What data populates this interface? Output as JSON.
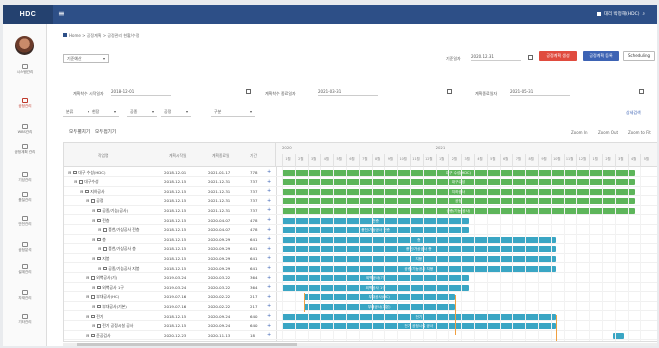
{
  "app": {
    "logo": "HDC",
    "menu_icon": "hamburger-icon"
  },
  "user": {
    "label": "대리 박정해(HDC)",
    "search_icon": "search-icon"
  },
  "sidebar": {
    "items": [
      {
        "label": "시스템관리",
        "icon": "monitor-icon"
      },
      {
        "label": "공정관리",
        "icon": "calendar-icon",
        "active": true
      },
      {
        "label": "WBS관리",
        "icon": "list-icon"
      },
      {
        "label": "공정계획 관리",
        "icon": "plan-icon"
      },
      {
        "label": "기성관리",
        "icon": "chart-icon"
      },
      {
        "label": "품질관리",
        "icon": "check-icon"
      },
      {
        "label": "안전관리",
        "icon": "shield-icon"
      },
      {
        "label": "공정분석",
        "icon": "analysis-icon"
      },
      {
        "label": "설계관리",
        "icon": "design-icon"
      },
      {
        "label": "자재관리",
        "icon": "box-icon"
      },
      {
        "label": "기타관리",
        "icon": "dots-icon"
      }
    ]
  },
  "breadcrumb": "Home > 공정계획 > 공정관리 현황/수정",
  "project_select": "기준예산",
  "version_label": "기준일자",
  "version_date": "2020.12.31",
  "buttons": {
    "publish": "공정계획 생성",
    "baseline": "공정계획 등록",
    "scheduling": "Scheduling"
  },
  "filters": {
    "start_label": "계획착수 시작일자",
    "start_value": "2018-12-01",
    "end_label": "계획착수 종료일자",
    "end_value": "2021-03-31",
    "status_label": "계획종료일자",
    "status_value": "2021-05-31",
    "selects": [
      "분류",
      "현장",
      "공종",
      "공정",
      "구분"
    ],
    "detail_search": "상세검색"
  },
  "gantt_toolbar": {
    "expand": "모두펼치기",
    "collapse": "모두접기기",
    "zoom_in": "Zoom In",
    "zoom_out": "Zoom Out",
    "zoom_fit": "Zoom to Fit"
  },
  "grid_headers": [
    "작업명",
    "계획시작일",
    "계획종료일",
    "기간"
  ],
  "timeline": {
    "years": [
      "2020",
      "2021"
    ],
    "months": [
      "1월",
      "2월",
      "3월",
      "4월",
      "5월",
      "6월",
      "7월",
      "8월",
      "9월",
      "10월",
      "11월",
      "12월",
      "1월",
      "2월",
      "3월",
      "4월",
      "5월",
      "6월",
      "7월",
      "8월",
      "9월",
      "10월",
      "11월",
      "12월",
      "1월",
      "2월",
      "3월",
      "4월",
      "5월"
    ]
  },
  "tasks": [
    {
      "name": "대구 수성(HDC)",
      "indent": 0,
      "start": "2018.12.01",
      "end": "2021.01.17",
      "dur": "778",
      "bar": "green",
      "bar_label": "대구 수성(HDC)",
      "from": 0,
      "to": 98
    },
    {
      "name": "대구수성",
      "indent": 1,
      "start": "2018.12.15",
      "end": "2021.12.31",
      "dur": "737",
      "bar": "green",
      "bar_label": "대구수성",
      "from": 0,
      "to": 98
    },
    {
      "name": "지하공사",
      "indent": 2,
      "start": "2018.12.15",
      "end": "2021.12.31",
      "dur": "737",
      "bar": "green",
      "bar_label": "지하공사",
      "from": 0,
      "to": 98
    },
    {
      "name": "공정",
      "indent": 3,
      "start": "2018.12.15",
      "end": "2021.12.31",
      "dur": "737",
      "bar": "green",
      "bar_label": "공정",
      "from": 0,
      "to": 98
    },
    {
      "name": "공종/기능(공사)",
      "indent": 4,
      "start": "2018.12.15",
      "end": "2021.12.31",
      "dur": "737",
      "bar": "green",
      "bar_label": "공종/기능(공사)",
      "from": 0,
      "to": 98
    },
    {
      "name": "전층",
      "indent": 4,
      "start": "2018.12.15",
      "end": "2020.04.07",
      "dur": "478",
      "bar": "teal",
      "bar_label": "전층",
      "from": 0,
      "to": 52
    },
    {
      "name": "풍천/가상공사 전층",
      "indent": 5,
      "start": "2018.12.15",
      "end": "2020.04.07",
      "dur": "478",
      "bar": "teal",
      "bar_label": "풍천/가상공사 전층",
      "from": 0,
      "to": 52
    },
    {
      "name": "층",
      "indent": 4,
      "start": "2018.12.15",
      "end": "2020.09.29",
      "dur": "641",
      "bar": "teal",
      "bar_label": "층",
      "from": 0,
      "to": 76
    },
    {
      "name": "풍천/가상공사 층",
      "indent": 5,
      "start": "2018.12.15",
      "end": "2020.09.29",
      "dur": "641",
      "bar": "teal",
      "bar_label": "풍천/가상공사 층",
      "from": 0,
      "to": 76
    },
    {
      "name": "지붕",
      "indent": 4,
      "start": "2018.12.15",
      "end": "2020.09.29",
      "dur": "641",
      "bar": "teal",
      "bar_label": "지붕",
      "from": 0,
      "to": 76
    },
    {
      "name": "공종/기능공사 지붕",
      "indent": 5,
      "start": "2018.12.15",
      "end": "2020.09.29",
      "dur": "641",
      "bar": "teal",
      "bar_label": "공종/기능공사 지붕",
      "from": 0,
      "to": 76
    },
    {
      "name": "외벽공사(기)",
      "indent": 3,
      "start": "2019.03.24",
      "end": "2020.03.22",
      "dur": "364",
      "bar": "teal",
      "bar_label": "외벽공사(기)",
      "from": 0,
      "to": 52
    },
    {
      "name": "외벽공사 1구",
      "indent": 4,
      "start": "2019.03.24",
      "end": "2020.03.22",
      "dur": "364",
      "bar": "teal",
      "bar_label": "외벽공사 1구",
      "from": 0,
      "to": 52
    },
    {
      "name": "부대공사(HC)",
      "indent": 3,
      "start": "2019.07.16",
      "end": "2020.02.22",
      "dur": "217",
      "bar": "teal",
      "bar_label": "부대공사(HC)",
      "from": 6,
      "to": 48
    },
    {
      "name": "부대공사(기본)",
      "indent": 4,
      "start": "2019.07.16",
      "end": "2020.02.22",
      "dur": "217",
      "bar": "teal",
      "bar_label": "부대공사(기본)",
      "from": 6,
      "to": 48
    },
    {
      "name": "전기",
      "indent": 3,
      "start": "2018.12.15",
      "end": "2020.09.24",
      "dur": "640",
      "bar": "teal",
      "bar_label": "전기",
      "from": 0,
      "to": 76
    },
    {
      "name": "전기 공정시설 공사",
      "indent": 4,
      "start": "2018.12.15",
      "end": "2020.09.24",
      "dur": "640",
      "bar": "teal",
      "bar_label": "전기 공정시설 공사",
      "from": 0,
      "to": 76
    },
    {
      "name": "준공검사",
      "indent": 3,
      "start": "2020.12.23",
      "end": "2020.11.13",
      "dur": "18",
      "bar": "teal",
      "bar_label": "",
      "from": 92,
      "to": 95
    }
  ]
}
